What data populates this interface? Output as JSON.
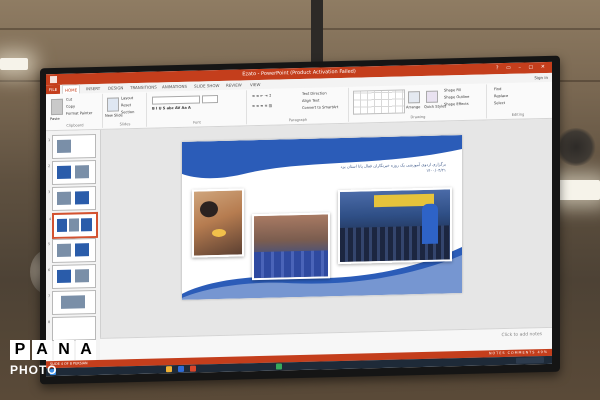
{
  "window": {
    "title": "Ezato - PowerPoint (Product Activation Failed)",
    "sign_in": "Sign in"
  },
  "ribbon_tabs": [
    "FILE",
    "HOME",
    "INSERT",
    "DESIGN",
    "TRANSITIONS",
    "ANIMATIONS",
    "SLIDE SHOW",
    "REVIEW",
    "VIEW"
  ],
  "ribbon": {
    "clipboard": {
      "label": "Clipboard",
      "paste": "Paste",
      "cut": "Cut",
      "copy": "Copy",
      "format_painter": "Format Painter"
    },
    "slides": {
      "label": "Slides",
      "new_slide": "New Slide",
      "layout": "Layout",
      "reset": "Reset",
      "section": "Section"
    },
    "font": {
      "label": "Font"
    },
    "paragraph": {
      "label": "Paragraph",
      "text_direction": "Text Direction",
      "align_text": "Align Text",
      "smartart": "Convert to SmartArt"
    },
    "drawing": {
      "label": "Drawing",
      "arrange": "Arrange",
      "quick_styles": "Quick Styles",
      "shape_fill": "Shape Fill",
      "shape_outline": "Shape Outline",
      "shape_effects": "Shape Effects"
    },
    "editing": {
      "label": "Editing",
      "find": "Find",
      "replace": "Replace",
      "select": "Select"
    }
  },
  "thumbnails": [
    "1",
    "2",
    "3",
    "4",
    "5",
    "6",
    "7",
    "8"
  ],
  "slide": {
    "heading_line1": "برگزاری اردوی آموزشی یک روزه خبرنگاران فعال پانا استان یزد",
    "heading_line2": "۱۴۰۰/۰۴/۲۱"
  },
  "notes_placeholder": "Click to add notes",
  "statusbar": {
    "left": "SLIDE 4 OF 8   PERSIAN",
    "right": "NOTES   COMMENTS   49%"
  },
  "watermark": {
    "letters": [
      "P",
      "A",
      "N",
      "A"
    ],
    "bottom": "PHOTO"
  }
}
